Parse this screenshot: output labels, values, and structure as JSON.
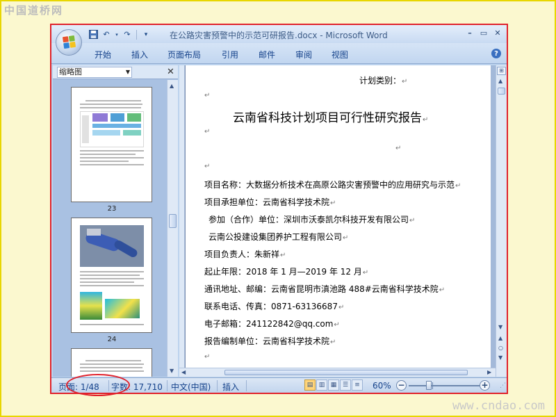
{
  "watermarks": {
    "top": "中国道桥网",
    "bottom": "www.cndao.com"
  },
  "window": {
    "title": "在公路灾害预警中的示范可研报告.docx - Microsoft Word"
  },
  "quick_access": {
    "save": "save-icon",
    "undo": "undo-icon",
    "redo": "redo-icon",
    "customize": "▾"
  },
  "window_controls": {
    "minimize": "–",
    "restore": "▭",
    "close": "✕"
  },
  "ribbon_tabs": [
    "开始",
    "插入",
    "页面布局",
    "引用",
    "邮件",
    "审阅",
    "视图"
  ],
  "thumbnail_pane": {
    "dropdown_value": "缩略图",
    "close": "✕",
    "pages": [
      {
        "number": "23"
      },
      {
        "number": "24"
      }
    ]
  },
  "document": {
    "plan_category": "计划类别：",
    "title": "云南省科技计划项目可行性研究报告",
    "lines": [
      "项目名称：大数据分析技术在高原公路灾害预警中的应用研究与示范",
      "项目承担单位：云南省科学技术院",
      "参加（合作）单位：深圳市沃泰凯尔科技开发有限公司",
      "云南公投建设集团养护工程有限公司",
      "项目负责人：朱新祥",
      "起止年限：2018 年 1 月—2019 年 12 月",
      "通讯地址、邮编：云南省昆明市滇池路 488#云南省科学技术院",
      "联系电话、传真：0871-63136687",
      "电子邮箱：241122842@qq.com",
      "报告编制单位：云南省科学技术院"
    ],
    "paragraph_mark": "↵"
  },
  "status_bar": {
    "page": "页面: 1/48",
    "words": "字数: 17,710",
    "language": "中文(中国)",
    "mode": "插入",
    "zoom": "60%",
    "zoom_value_percent": 60
  },
  "colors": {
    "annotation": "#e0202a",
    "page_background": "#fbf8cf",
    "ribbon_text": "#15428b"
  }
}
